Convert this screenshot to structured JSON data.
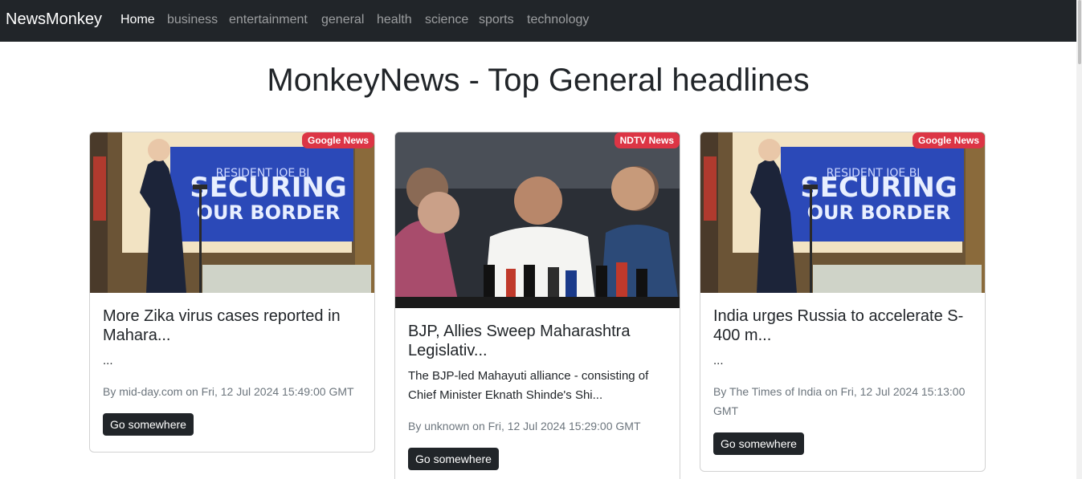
{
  "navbar": {
    "brand": "NewsMonkey",
    "links": [
      "Home",
      "business",
      "entertainment",
      "general",
      "health",
      "science",
      "sports",
      "technology"
    ]
  },
  "page": {
    "title": "MonkeyNews - Top General headlines"
  },
  "cards": [
    {
      "source": "Google News",
      "image": "biden-border-photo",
      "image_text": [
        "RESIDENT JOE BI",
        "SECURING",
        "OUR BORDER"
      ],
      "title": "More Zika virus cases reported in Mahara...",
      "description": "...",
      "meta": "By mid-day.com on Fri, 12 Jul 2024 15:49:00 GMT",
      "button": "Go somewhere"
    },
    {
      "source": "NDTV News",
      "image": "maharashtra-press-photo",
      "image_text": [],
      "title": "BJP, Allies Sweep Maharashtra Legislativ...",
      "description": "The BJP-led Mahayuti alliance - consisting of Chief Minister Eknath Shinde's Shi...",
      "meta": "By unknown on Fri, 12 Jul 2024 15:29:00 GMT",
      "button": "Go somewhere"
    },
    {
      "source": "Google News",
      "image": "biden-border-photo",
      "image_text": [
        "RESIDENT JOE BI",
        "SECURING",
        "OUR BORDER"
      ],
      "title": "India urges Russia to accelerate S-400 m...",
      "description": "...",
      "meta": "By The Times of India on Fri, 12 Jul 2024 15:13:00 GMT",
      "button": "Go somewhere"
    }
  ],
  "colors": {
    "navbar_bg": "#212529",
    "badge_bg": "#dc3545",
    "button_bg": "#212529",
    "meta_text": "#6c757d"
  }
}
